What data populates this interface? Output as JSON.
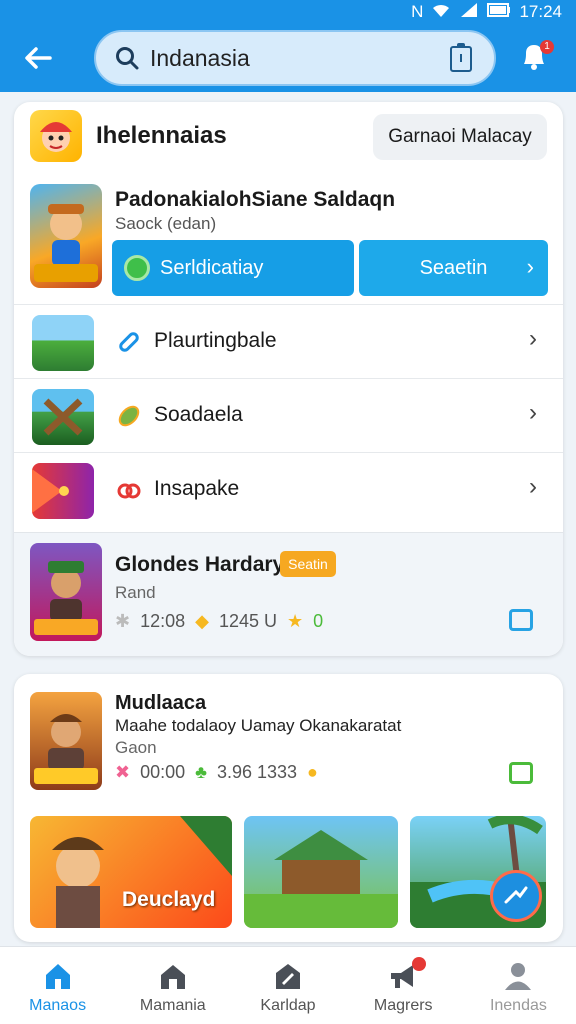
{
  "status_bar": {
    "time": "17:24"
  },
  "app_bar": {
    "back_icon": "arrow-left-icon",
    "search_value": "Indanasia",
    "notification_badge": "1"
  },
  "card1": {
    "title": "Ihelennaias",
    "chip_label": "Garnaoi Malacay",
    "featured": {
      "title": "PadonakialohSiane Saldaqn",
      "subtitle": "Saock (edan)",
      "primary_button": "Serldicatiay",
      "secondary_button": "Seaetin"
    },
    "rows": [
      {
        "label": "Plaurtingbale",
        "icon": "link-icon"
      },
      {
        "label": "Soadaela",
        "icon": "leaf-icon"
      },
      {
        "label": "Insapake",
        "icon": "rings-icon"
      }
    ],
    "game": {
      "title": "Glondes Hardary",
      "badge": "Seatin",
      "subtitle": "Rand",
      "stat1": "12:08",
      "stat2": "1245 U",
      "stat3": "0"
    }
  },
  "card2": {
    "title": "Mudlaaca",
    "line": "Maahe todalaoy Uamay  Okanakaratat",
    "subtitle": "Gaon",
    "stat1": "00:00",
    "stat2": "3.96  1333",
    "tile_label": "Deuclayd"
  },
  "bottom_nav": [
    {
      "label": "Manaos",
      "icon": "home-icon",
      "active": true
    },
    {
      "label": "Mamania",
      "icon": "store-icon",
      "active": false
    },
    {
      "label": "Karldap",
      "icon": "edit-icon",
      "active": false
    },
    {
      "label": "Magrers",
      "icon": "megaphone-icon",
      "active": false
    },
    {
      "label": "Inendas",
      "icon": "person-icon",
      "active": false
    }
  ],
  "colors": {
    "primary": "#1a92e6",
    "accent": "#f6a821",
    "success": "#4bbb3a"
  }
}
